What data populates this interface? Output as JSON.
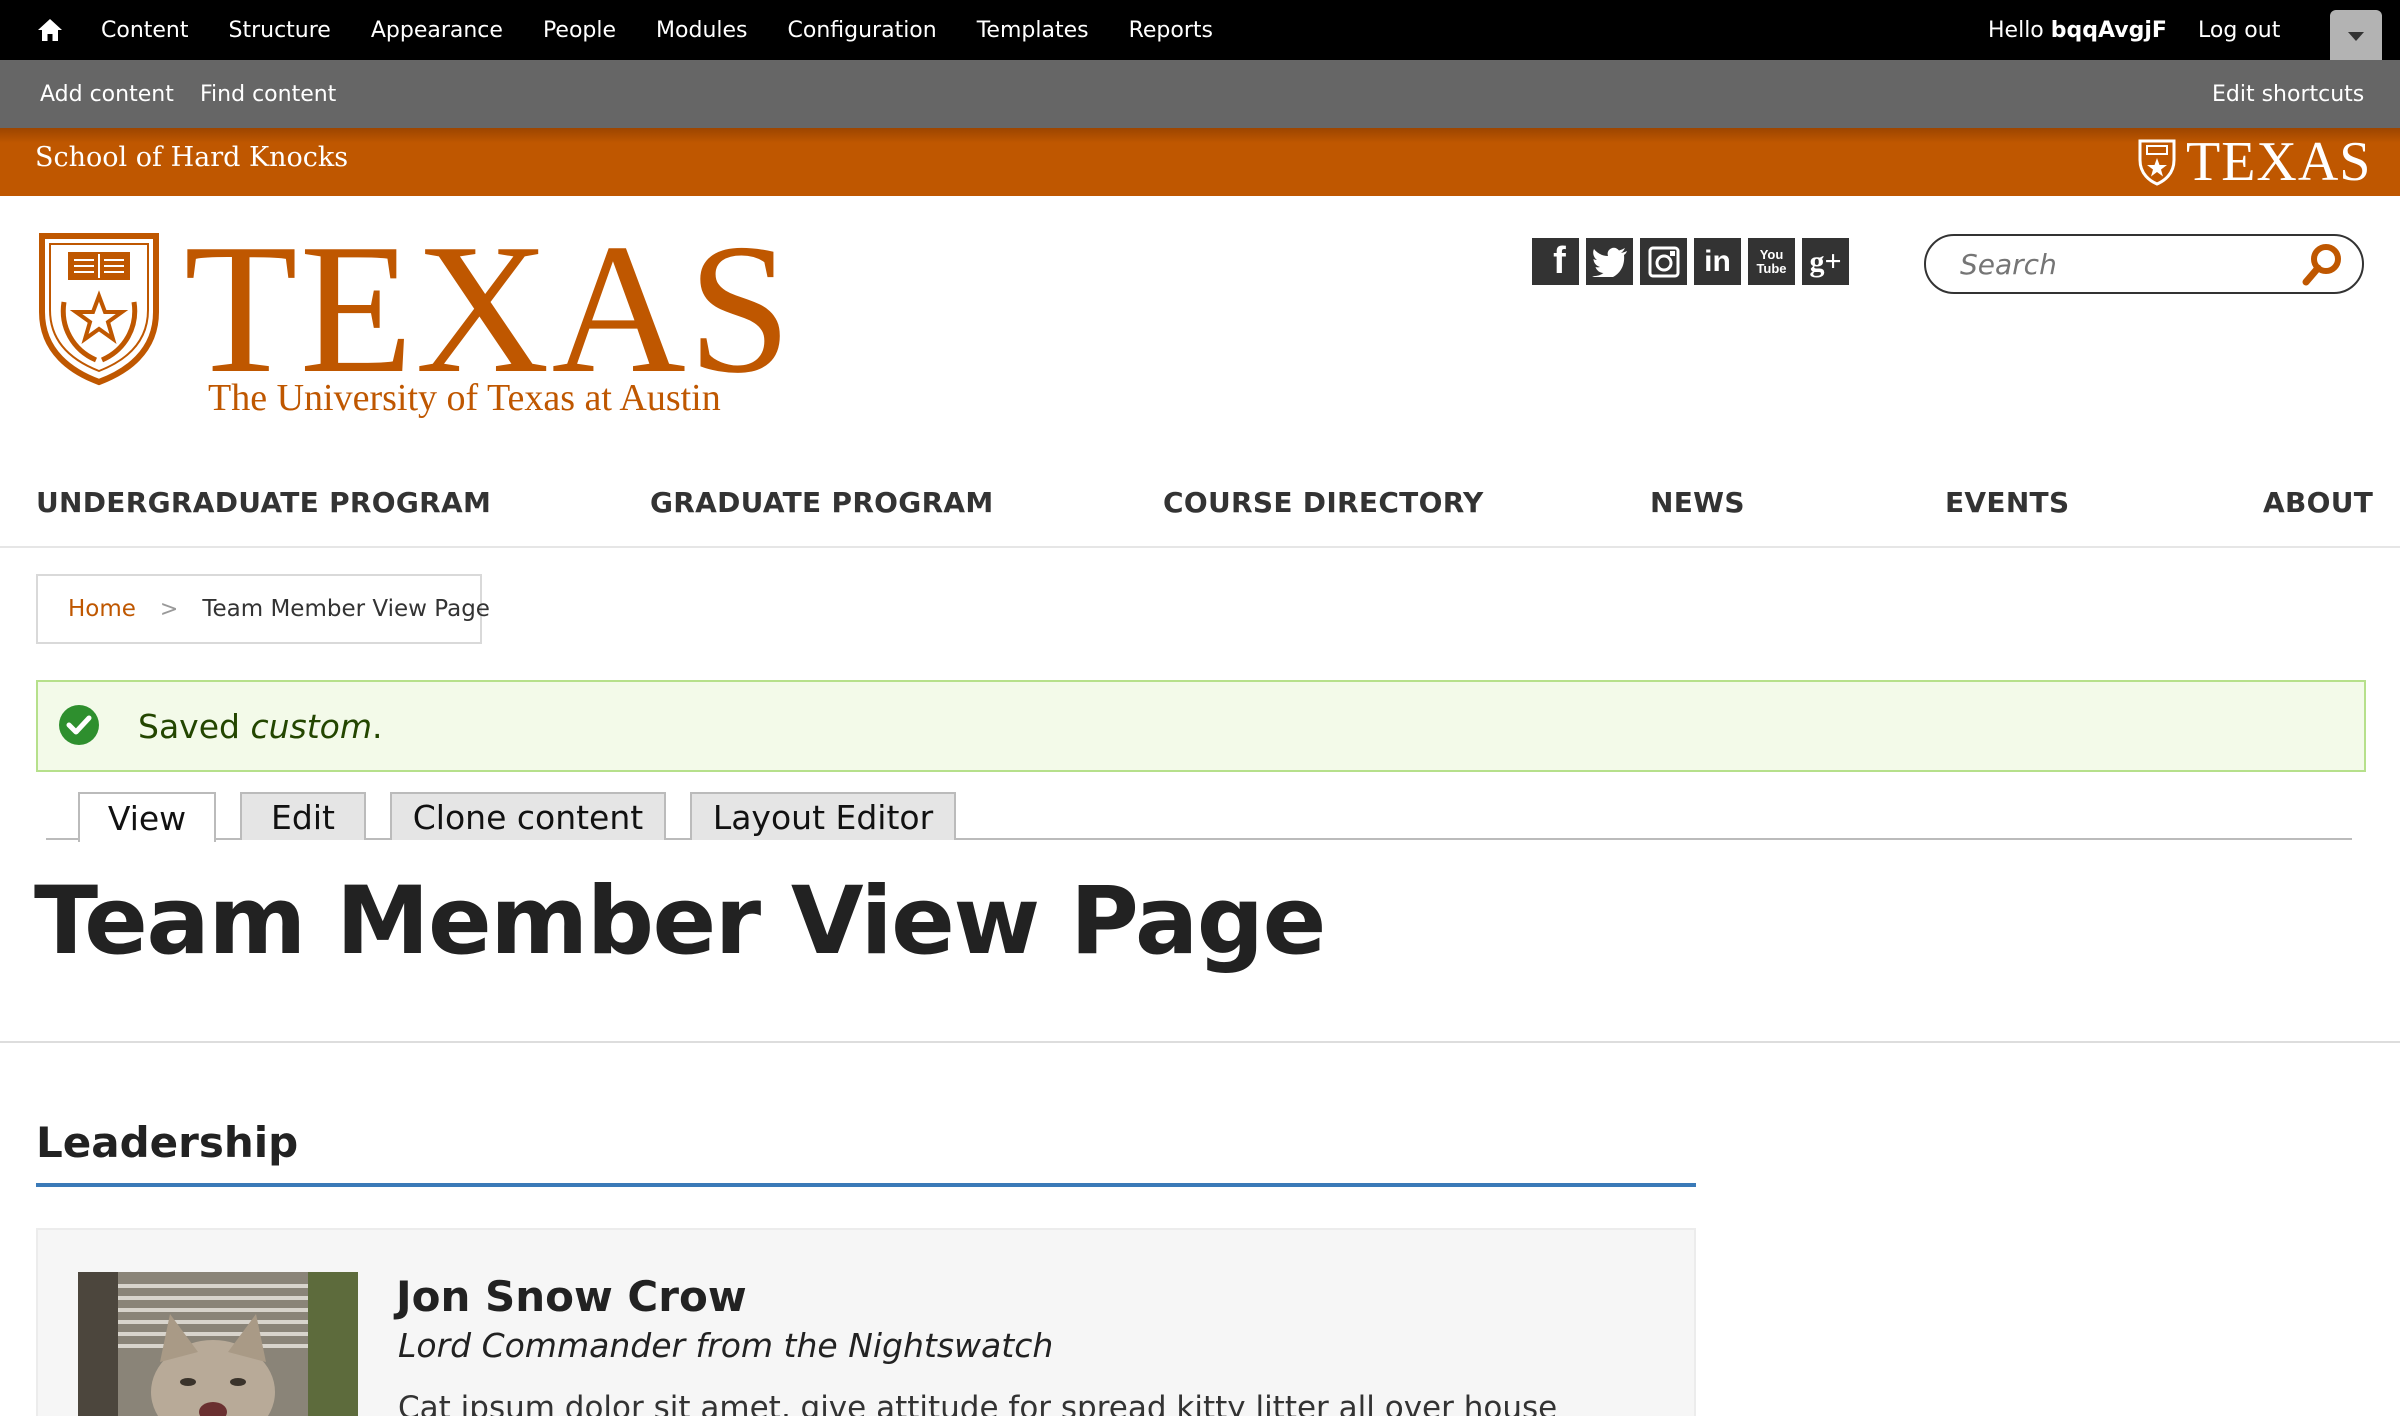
{
  "admin_toolbar": {
    "menu": [
      "Content",
      "Structure",
      "Appearance",
      "People",
      "Modules",
      "Configuration",
      "Templates",
      "Reports"
    ],
    "hello_prefix": "Hello ",
    "username": "bqqAvgjF",
    "logout": "Log out"
  },
  "shortcuts": {
    "add_content": "Add content",
    "find_content": "Find content",
    "edit_shortcuts": "Edit shortcuts"
  },
  "parent_banner": {
    "unit_name": "School of Hard Knocks",
    "brand": "TEXAS"
  },
  "logo": {
    "wordmark": "TEXAS",
    "subtitle": "The University of Texas at Austin"
  },
  "social": [
    "facebook-icon",
    "twitter-icon",
    "instagram-icon",
    "linkedin-icon",
    "youtube-icon",
    "google-plus-icon"
  ],
  "search": {
    "placeholder": "Search"
  },
  "main_nav": [
    "UNDERGRADUATE PROGRAM",
    "GRADUATE PROGRAM",
    "COURSE DIRECTORY",
    "NEWS",
    "EVENTS",
    "ABOUT"
  ],
  "breadcrumb": {
    "home": "Home",
    "separator": ">",
    "current": "Team Member View Page"
  },
  "status": {
    "prefix": "Saved ",
    "item": "custom",
    "suffix": "."
  },
  "tabs": [
    "View",
    "Edit",
    "Clone content",
    "Layout Editor"
  ],
  "page_title": "Team Member View Page",
  "section": {
    "heading": "Leadership"
  },
  "team_member": {
    "name": "Jon Snow Crow",
    "role": "Lord Commander from the Nightswatch",
    "bio": "Cat ipsum dolor sit amet, give attitude for spread kitty litter all over house"
  },
  "colors": {
    "burnt_orange": "#bf5700",
    "status_green": "#2e8f2e",
    "section_rule": "#3a7ab8"
  }
}
